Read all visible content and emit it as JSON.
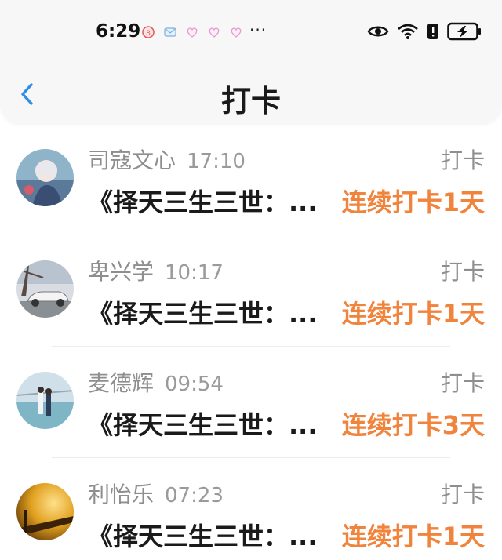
{
  "status_bar": {
    "time": "6:29",
    "more": "···"
  },
  "nav": {
    "title": "打卡",
    "back_icon": "chevron-left-icon"
  },
  "colors": {
    "accent_blue": "#2f8fe8",
    "streak_orange": "#f0843c",
    "muted_gray": "#8e8e8e"
  },
  "items": [
    {
      "name": "司寇文心",
      "time": "17:10",
      "action": "打卡",
      "book": "《择天三生三世：...",
      "streak": "连续打卡1天"
    },
    {
      "name": "卑兴学",
      "time": "10:17",
      "action": "打卡",
      "book": "《择天三生三世：...",
      "streak": "连续打卡1天"
    },
    {
      "name": "麦德辉",
      "time": "09:54",
      "action": "打卡",
      "book": "《择天三生三世：...",
      "streak": "连续打卡3天"
    },
    {
      "name": "利怡乐",
      "time": "07:23",
      "action": "打卡",
      "book": "《择天三生三世：...",
      "streak": "连续打卡1天"
    }
  ]
}
